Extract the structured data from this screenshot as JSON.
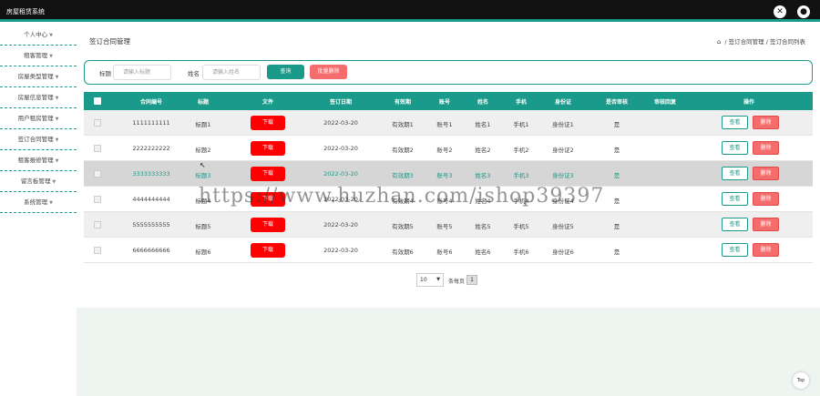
{
  "app": {
    "title": "房屋租赁系统"
  },
  "colors": {
    "accent": "#1a9a8a",
    "danger": "#f56c6c",
    "download": "#ff0000"
  },
  "top_icons": [
    "close-icon",
    "user-icon"
  ],
  "sidebar": {
    "items": [
      {
        "label": "个人中心"
      },
      {
        "label": "租客管理"
      },
      {
        "label": "房屋类型管理"
      },
      {
        "label": "房屋信息管理"
      },
      {
        "label": "用户租房管理"
      },
      {
        "label": "签订合同管理"
      },
      {
        "label": "租客报修管理"
      },
      {
        "label": "留言板管理"
      },
      {
        "label": "系统管理"
      }
    ]
  },
  "page": {
    "title": "签订合同管理"
  },
  "breadcrumb": {
    "parent": "签订合同管理",
    "sep": "/",
    "current": "签订合同列表"
  },
  "search": {
    "title_label": "标题",
    "title_placeholder": "请输入标题",
    "name_label": "姓名",
    "name_placeholder": "请输入姓名",
    "query_button": "查询",
    "batch_delete_button": "批量删除"
  },
  "table": {
    "headers": [
      "合同编号",
      "标题",
      "文件",
      "签订日期",
      "有效期",
      "账号",
      "姓名",
      "手机",
      "身份证",
      "是否审核",
      "审核回复",
      "操作"
    ],
    "rows": [
      {
        "contract_no": "1111111111",
        "title": "标题1",
        "file": "下载",
        "date": "2022-03-20",
        "validity": "有效期1",
        "account": "账号1",
        "name": "姓名1",
        "phone": "手机1",
        "id_card": "身份证1",
        "reviewed": "是",
        "reply": "",
        "view": "查看",
        "delete": "删除"
      },
      {
        "contract_no": "2222222222",
        "title": "标题2",
        "file": "下载",
        "date": "2022-03-20",
        "validity": "有效期2",
        "account": "账号2",
        "name": "姓名2",
        "phone": "手机2",
        "id_card": "身份证2",
        "reviewed": "是",
        "reply": "",
        "view": "查看",
        "delete": "删除"
      },
      {
        "contract_no": "3333333333",
        "title": "标题3",
        "file": "下载",
        "date": "2022-03-20",
        "validity": "有效期3",
        "account": "账号3",
        "name": "姓名3",
        "phone": "手机3",
        "id_card": "身份证3",
        "reviewed": "是",
        "reply": "",
        "view": "查看",
        "delete": "删除"
      },
      {
        "contract_no": "4444444444",
        "title": "标题4",
        "file": "下载",
        "date": "2022-03-20",
        "validity": "有效期4",
        "account": "账号4",
        "name": "姓名4",
        "phone": "手机4",
        "id_card": "身份证4",
        "reviewed": "是",
        "reply": "",
        "view": "查看",
        "delete": "删除"
      },
      {
        "contract_no": "5555555555",
        "title": "标题5",
        "file": "下载",
        "date": "2022-03-20",
        "validity": "有效期5",
        "account": "账号5",
        "name": "姓名5",
        "phone": "手机5",
        "id_card": "身份证5",
        "reviewed": "是",
        "reply": "",
        "view": "查看",
        "delete": "删除"
      },
      {
        "contract_no": "6666666666",
        "title": "标题6",
        "file": "下载",
        "date": "2022-03-20",
        "validity": "有效期6",
        "account": "账号6",
        "name": "姓名6",
        "phone": "手机6",
        "id_card": "身份证6",
        "reviewed": "是",
        "reply": "",
        "view": "查看",
        "delete": "删除"
      }
    ],
    "highlighted_row": 2
  },
  "pagination": {
    "page_size": "10",
    "total_text": "条每页",
    "current_page": "1"
  },
  "back_to_top": "Top",
  "watermark": "https://www.huzhan.com/ishop39397"
}
